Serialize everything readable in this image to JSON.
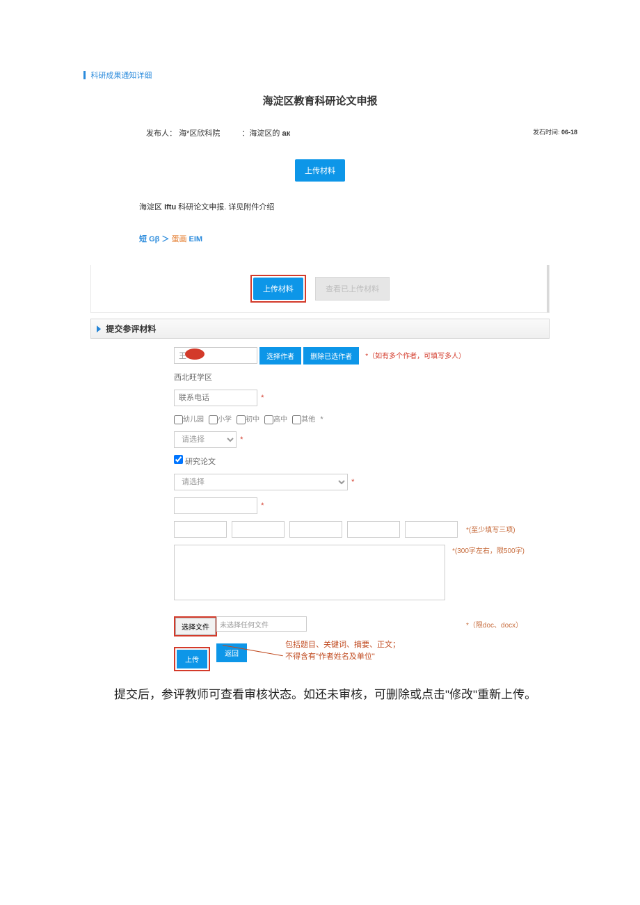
{
  "crumb": "科研成果通知详细",
  "title": "海淀区教育科研论文申报",
  "meta": {
    "publisher_label": "发布人：",
    "publisher": "海*区欣科院",
    "scope_prefix": "：海淀区的 ",
    "scope_bold": "aк",
    "time_label": "发石时间:",
    "time_value": "06-18"
  },
  "btn_upload_material": "上传材料",
  "intro": {
    "p1a": "海淀区 ",
    "p1b": "Iftu",
    "p1c": " 科研论文申报. 详见附件介绍"
  },
  "linkline": {
    "a": "短 ",
    "b": "Gβ",
    "c": "＞",
    "d": "蛋画 ",
    "e": "EIM"
  },
  "btn_upload_material2": "上传材料",
  "btn_view_uploaded": "查看已上传材料",
  "section_title": "提交参评材料",
  "form": {
    "name_value": "王",
    "btn_select_author": "选择作者",
    "btn_delete_author": "删除已选作者",
    "multi_author_note": "（如有多个作者，可填写多人）",
    "district": "西北旺学区",
    "phone_placeholder": "联系电话",
    "grades": [
      "幼儿园",
      "小学",
      "初中",
      "高中",
      "其他"
    ],
    "grade_after": "*",
    "select_placeholder": "请选择",
    "paper_type_label": "研究论文",
    "select2_placeholder": "请选择",
    "kw_hint": "*(至少填写三项)",
    "abs_hint": "*(300字左右，限500字)",
    "btn_choose_file": "选择文件",
    "no_file": "未选择任何文件",
    "file_hint": "*（限doc、docx）",
    "btn_upload": "上传",
    "btn_back": "返回",
    "callout1": "包括题目、关键词、摘要、正文；",
    "callout2": "不得含有\"作者姓名及单位\""
  },
  "body_text": "提交后，参评教师可查看审核状态。如还未审核，可删除或点击\"修改\"重新上传。"
}
